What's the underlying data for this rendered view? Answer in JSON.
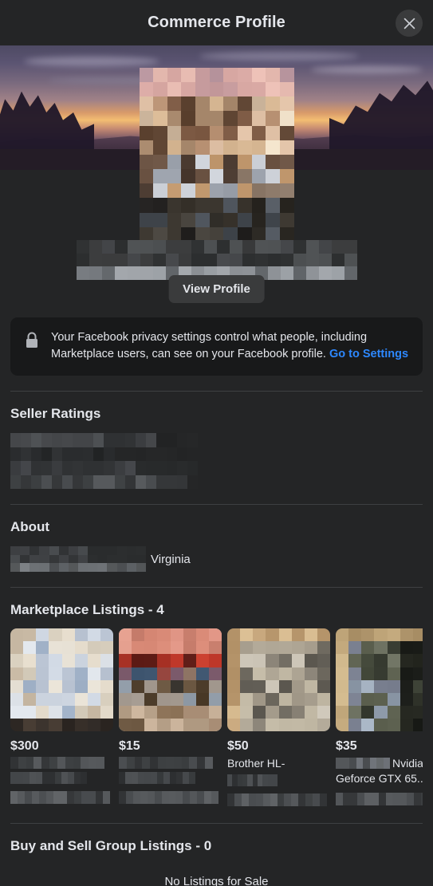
{
  "titlebar": {
    "title": "Commerce Profile",
    "close_label": "Close",
    "close_icon": "close-icon"
  },
  "profile": {
    "cover_photo_alt": "sunset mountain landscape cover photo",
    "profile_photo_alt": "blurred profile photo",
    "name_redacted": true,
    "view_profile_label": "View Profile"
  },
  "privacy_notice": {
    "icon": "lock-icon",
    "text": "Your Facebook privacy settings control what people, including Marketplace users, can see on your Facebook profile. ",
    "link_label": "Go to Settings"
  },
  "seller_ratings": {
    "title": "Seller Ratings",
    "content_redacted": true
  },
  "about": {
    "title": "About",
    "redacted_prefix": true,
    "location": "Virginia"
  },
  "marketplace_listings": {
    "title": "Marketplace Listings - 4",
    "count": 4,
    "items": [
      {
        "price": "$300",
        "title": "",
        "title_redacted": true,
        "location_redacted": true,
        "thumb_alt": "pastel pixelated item photo",
        "selected": false
      },
      {
        "price": "$15",
        "title": "",
        "title_redacted": true,
        "location_redacted": true,
        "thumb_alt": "red and tan pixelated item photo",
        "selected": true
      },
      {
        "price": "$50",
        "title": "Brother HL-",
        "title_redacted": true,
        "location_redacted": true,
        "thumb_alt": "printer on wooden floor",
        "selected": false
      },
      {
        "price": "$35",
        "title": "Nvidia Geforce GTX 65...",
        "title_redacted": true,
        "location_redacted": true,
        "thumb_alt": "GIGABYTE GeForce GTX 650 graphics card box",
        "selected": false
      }
    ]
  },
  "group_listings": {
    "title": "Buy and Sell Group Listings - 0",
    "count": 0,
    "empty_message": "No Listings for Sale"
  },
  "colors": {
    "background": "#242526",
    "surface": "#18191a",
    "text": "#e4e6eb",
    "link": "#2d88ff",
    "button": "#3a3b3c",
    "divider": "#3e4042"
  }
}
